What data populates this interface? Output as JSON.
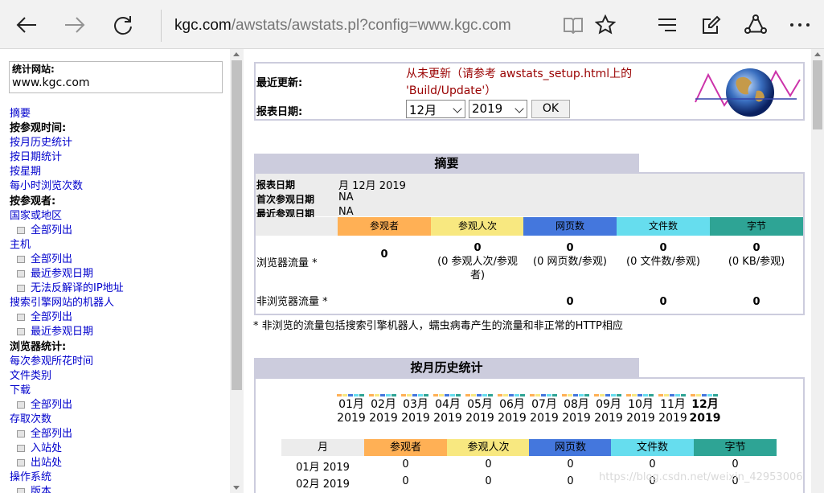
{
  "browser": {
    "address_host": "kgc.com",
    "address_rest": "/awstats/awstats.pl?config=www.kgc.com"
  },
  "nav": {
    "site_label": "统计网站:",
    "site_value": "www.kgc.com",
    "items": [
      {
        "type": "link",
        "label": "摘要"
      },
      {
        "type": "head",
        "label": "按参观时间:"
      },
      {
        "type": "link",
        "label": "按月历史统计"
      },
      {
        "type": "link",
        "label": "按日期统计"
      },
      {
        "type": "link",
        "label": "按星期"
      },
      {
        "type": "link",
        "label": "每小时浏览次数"
      },
      {
        "type": "head",
        "label": "按参观者:"
      },
      {
        "type": "link",
        "label": "国家或地区"
      },
      {
        "type": "sub",
        "label": "全部列出"
      },
      {
        "type": "link",
        "label": "主机"
      },
      {
        "type": "sub",
        "label": "全部列出"
      },
      {
        "type": "sub",
        "label": "最近参观日期"
      },
      {
        "type": "sub",
        "label": "无法反解译的IP地址"
      },
      {
        "type": "link",
        "label": "搜索引擎网站的机器人"
      },
      {
        "type": "sub",
        "label": "全部列出"
      },
      {
        "type": "sub",
        "label": "最近参观日期"
      },
      {
        "type": "head",
        "label": "浏览器统计:"
      },
      {
        "type": "link",
        "label": "每次参观所花时间"
      },
      {
        "type": "link",
        "label": "文件类别"
      },
      {
        "type": "link",
        "label": "下载"
      },
      {
        "type": "sub",
        "label": "全部列出"
      },
      {
        "type": "link",
        "label": "存取次数"
      },
      {
        "type": "sub",
        "label": "全部列出"
      },
      {
        "type": "sub",
        "label": "入站处"
      },
      {
        "type": "sub",
        "label": "出站处"
      },
      {
        "type": "link",
        "label": "操作系统"
      },
      {
        "type": "sub",
        "label": "版本"
      }
    ]
  },
  "update": {
    "last_update_label": "最近更新:",
    "last_update_value": "从未更新（请参考 awstats_setup.html上的 'Build/Update'）",
    "report_date_label": "报表日期:",
    "month": "12月",
    "year": "2019",
    "ok_label": "OK"
  },
  "summary": {
    "title": "摘要",
    "report_date_k": "报表日期",
    "report_date_v": "月 12月 2019",
    "first_visit_k": "首次参观日期",
    "first_visit_v": "NA",
    "last_visit_k": "最近参观日期",
    "last_visit_v": "NA",
    "columns": [
      "参观者",
      "参观人次",
      "网页数",
      "文件数",
      "字节"
    ],
    "column_colors": [
      "#ffb055",
      "#f8e880",
      "#4477dd",
      "#66ddee",
      "#2ea495"
    ],
    "browser_label": "浏览器流量 *",
    "browser_vals": [
      "0",
      "0",
      "0",
      "0",
      "0"
    ],
    "browser_subs": [
      "",
      "(0 参观人次/参观者)",
      "(0 网页数/参观)",
      "(0 文件数/参观)",
      "(0 KB/参观)"
    ],
    "nonbrowser_label": "非浏览器流量 *",
    "nonbrowser_vals": [
      "0",
      "0",
      "0"
    ],
    "footnote": "* 非浏览的流量包括搜索引擎机器人，蠕虫病毒产生的流量和非正常的HTTP相应"
  },
  "monthly": {
    "title": "按月历史统计",
    "months": [
      "01月",
      "02月",
      "03月",
      "04月",
      "05月",
      "06月",
      "07月",
      "08月",
      "09月",
      "10月",
      "11月",
      "12月"
    ],
    "year": "2019",
    "table_cols": [
      "月",
      "参观者",
      "参观人次",
      "网页数",
      "文件数",
      "字节"
    ],
    "rows": [
      {
        "month": "01月 2019",
        "vals": [
          "0",
          "0",
          "0",
          "0",
          "0"
        ]
      },
      {
        "month": "02月 2019",
        "vals": [
          "0",
          "0",
          "0",
          "0",
          "0"
        ]
      }
    ]
  },
  "watermark": "https://blog.csdn.net/weixin_42953006"
}
